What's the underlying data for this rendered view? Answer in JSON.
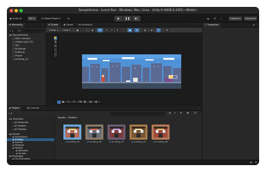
{
  "window": {
    "title": "SampleScene - Lunch-Run - Windows, Mac, Linux - Unity 6 (6000.0.24f1) <Metal>"
  },
  "toolbar": {
    "account": "Unity 6",
    "account_dropdown": "MC",
    "asset_store": "Asset Store",
    "layers_label": "Layers",
    "layout_label": "Layout"
  },
  "hierarchy": {
    "tab_label": "Hierarchy",
    "search_placeholder": "All",
    "items": [
      {
        "label": "SampleScene",
        "depth": 0
      },
      {
        "label": "Main Camera",
        "depth": 1
      },
      {
        "label": "Global Light 2D",
        "depth": 1
      },
      {
        "label": "Sky",
        "depth": 1
      },
      {
        "label": "Buildings",
        "depth": 1
      },
      {
        "label": "Platform",
        "depth": 1
      },
      {
        "label": "Player",
        "depth": 1
      },
      {
        "label": "building_01",
        "depth": 1
      }
    ]
  },
  "scene": {
    "tabs": [
      "Scene",
      "Game",
      "Animator"
    ],
    "center_label": "Center",
    "local_label": "Local",
    "mode_2d": "2D"
  },
  "inspector": {
    "tab_label": "Inspector"
  },
  "project": {
    "tabs": [
      "Project",
      "Console"
    ],
    "breadcrumb": [
      "Assets",
      "Prefabs"
    ],
    "favorites": [
      {
        "label": "Favorites",
        "depth": 0
      },
      {
        "label": "All Materials",
        "depth": 1
      },
      {
        "label": "All Models",
        "depth": 1
      },
      {
        "label": "All Prefabs",
        "depth": 1
      }
    ],
    "tree": [
      {
        "label": "Assets",
        "depth": 0
      },
      {
        "label": "Animations",
        "depth": 1
      },
      {
        "label": "Prefabs",
        "depth": 1,
        "selected": true
      },
      {
        "label": "Scenes",
        "depth": 1
      },
      {
        "label": "Settings",
        "depth": 1
      },
      {
        "label": "Sprites",
        "depth": 1
      },
      {
        "label": "Blenders",
        "depth": 2
      },
      {
        "label": "Scripts",
        "depth": 2
      },
      {
        "label": "Packages",
        "depth": 0
      },
      {
        "label": "2D Animation",
        "depth": 1
      }
    ],
    "assets": [
      "building_01",
      "building_02",
      "building_03",
      "building_04",
      "building_05"
    ]
  },
  "status_count": "23"
}
